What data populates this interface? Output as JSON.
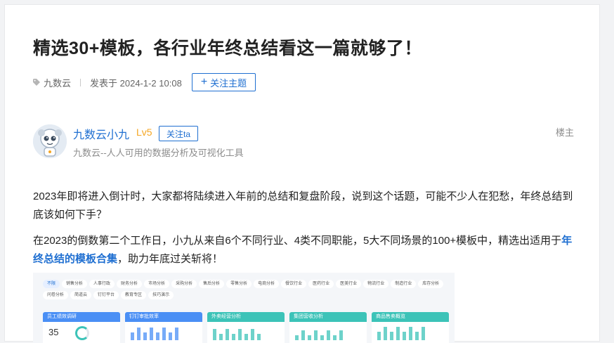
{
  "article": {
    "title": "精选30+模板，各行业年终总结看这一篇就够了！",
    "category": "九数云",
    "published": "发表于 2024-1-2 10:08",
    "follow_topic_label": "关注主题"
  },
  "author": {
    "name": "九数云小九",
    "level": "Lv5",
    "follow_label": "关注ta",
    "description": "九数云--人人可用的数据分析及可视化工具",
    "badge": "楼主"
  },
  "body": {
    "p1": "2023年即将进入倒计时，大家都将陆续进入年前的总结和复盘阶段，说到这个话题，可能不少人在犯愁，年终总结到底该如何下手？",
    "p2_before": "在2023的倒数第二个工作日，小九从来自6个不同行业、4类不同职能，5大不同场景的100+模板中，精选出适用于",
    "p2_highlight": "年终总结的模板合集",
    "p2_after": "，助力年底过关斩将！"
  },
  "preview": {
    "chips": [
      "不限",
      "销售分析",
      "人事行政",
      "财务分析",
      "市场分析",
      "采购分析",
      "售后分析",
      "零售分析",
      "电商分析",
      "餐饮行业",
      "医药行业",
      "医美行业",
      "物流行业",
      "制造行业",
      "库存分析",
      "问卷分析",
      "简道云",
      "钉钉平台",
      "教育专区",
      "技巧演示"
    ],
    "cards": [
      {
        "title": "员工绩效调研",
        "color": "#4a8ff5",
        "stat": "35"
      },
      {
        "title": "钉钉审批效率",
        "color": "#4a8ff5",
        "stat": ""
      },
      {
        "title": "外卖经营分析",
        "color": "#3cc3b8",
        "stat": ""
      },
      {
        "title": "集团营收分析",
        "color": "#3cc3b8",
        "stat": ""
      },
      {
        "title": "商品售卖概览",
        "color": "#3cc3b8",
        "stat": ""
      }
    ]
  },
  "colors": {
    "accent": "#1f6fd1",
    "level": "#f5a623"
  }
}
